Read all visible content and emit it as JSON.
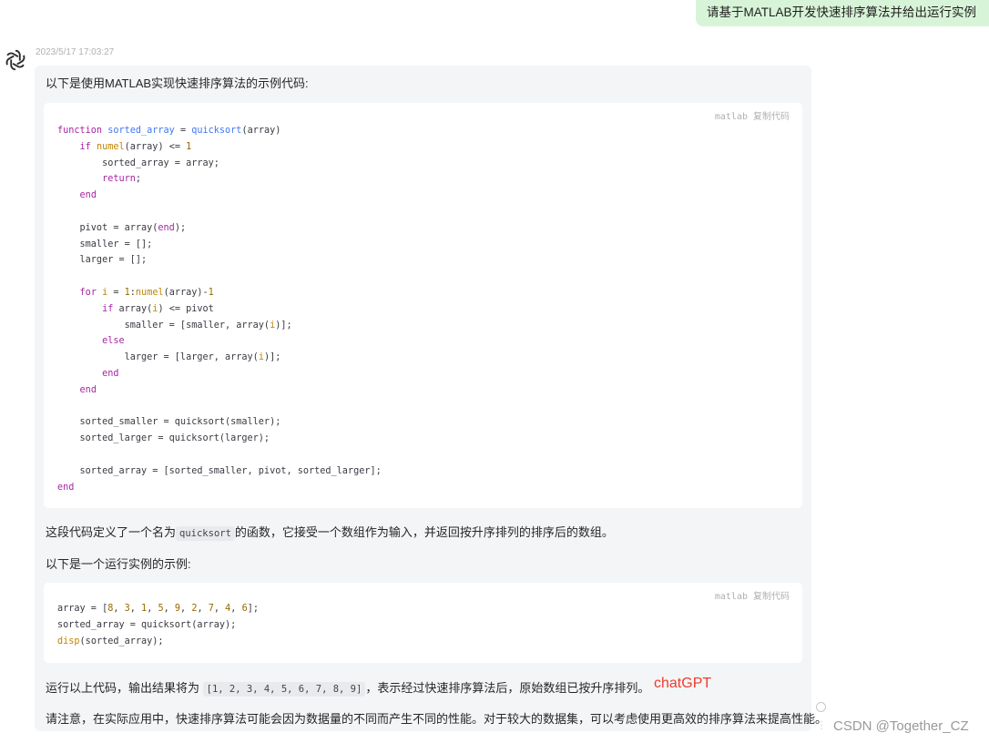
{
  "user_message": "请基于MATLAB开发快速排序算法并给出运行实例",
  "timestamp": "2023/5/17 17:03:27",
  "answer": {
    "intro": "以下是使用MATLAB实现快速排序算法的示例代码:",
    "code_block_1": {
      "lang": "matlab",
      "copy_label": "复制代码"
    },
    "explain_before": "这段代码定义了一个名为",
    "explain_code": "quicksort",
    "explain_after": "的函数，它接受一个数组作为输入，并返回按升序排列的排序后的数组。",
    "example_intro": "以下是一个运行实例的示例:",
    "code_block_2": {
      "lang": "matlab",
      "copy_label": "复制代码"
    },
    "result_before": "运行以上代码，输出结果将为",
    "result_code": "[1, 2, 3, 4, 5, 6, 7, 8, 9]",
    "result_after": "，表示经过快速排序算法后，原始数组已按升序排列。",
    "note": "请注意，在实际应用中，快速排序算法可能会因为数据量的不同而产生不同的性能。对于较大的数据集，可以考虑使用更高效的排序算法来提高性能。"
  },
  "annotation_label": "chatGPT",
  "watermark": "CSDN @Together_CZ",
  "icons": {
    "avatar": "openai-logo-icon",
    "user_more": "more-vertical-icon",
    "regenerate": "circle-icon",
    "answer_more": "more-vertical-icon"
  },
  "colors": {
    "user_bubble": "#d8f4d8",
    "answer_bg": "#f4f5f7",
    "annotation": "#f03b2e"
  }
}
